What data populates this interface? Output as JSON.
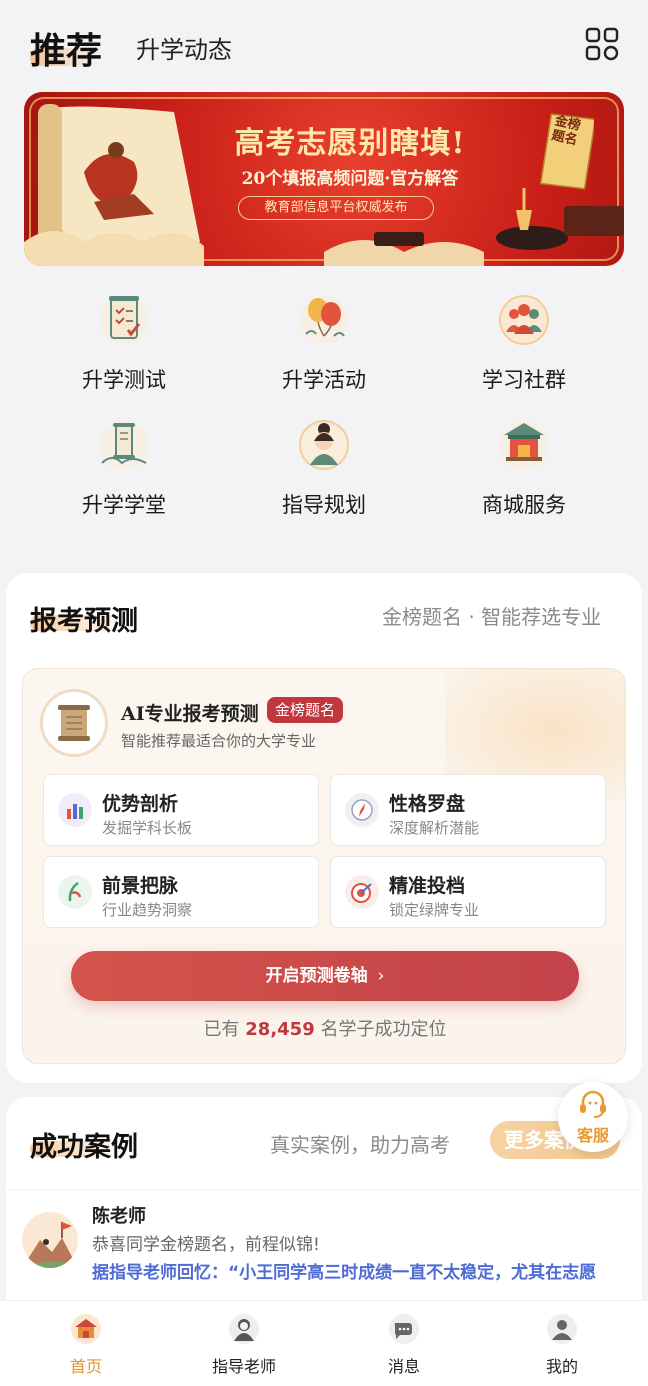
{
  "header": {
    "tab_active": "推荐",
    "tab_other": "升学动态"
  },
  "banner": {
    "title": "高考志愿别瞎填!",
    "subtitle": "20个填报高频问题·官方解答",
    "tag": "教育部信息平台权威发布",
    "seal": "金榜题名"
  },
  "quick_grid": [
    {
      "label": "升学测试",
      "icon": "checklist-scroll-icon"
    },
    {
      "label": "升学活动",
      "icon": "balloons-icon"
    },
    {
      "label": "学习社群",
      "icon": "community-people-icon"
    },
    {
      "label": "升学学堂",
      "icon": "scroll-lecture-icon"
    },
    {
      "label": "指导规划",
      "icon": "advisor-portrait-icon"
    },
    {
      "label": "商城服务",
      "icon": "shop-pavilion-icon"
    }
  ],
  "forecast": {
    "title": "报考预测",
    "subtitle": "金榜题名 · 智能荐选专业",
    "ai_title": "AI专业报考预测",
    "ai_badge": "金榜题名",
    "ai_desc": "智能推荐最适合你的大学专业",
    "features": [
      {
        "title": "优势剖析",
        "desc": "发掘学科长板",
        "icon": "bar-chart-icon"
      },
      {
        "title": "性格罗盘",
        "desc": "深度解析潜能",
        "icon": "compass-icon"
      },
      {
        "title": "前景把脉",
        "desc": "行业趋势洞察",
        "icon": "trend-leaf-icon"
      },
      {
        "title": "精准投档",
        "desc": "锁定绿牌专业",
        "icon": "target-icon"
      }
    ],
    "cta": "开启预测卷轴",
    "stat_prefix": "已有",
    "stat_number": "28,459",
    "stat_suffix": "名学子成功定位"
  },
  "cases": {
    "title": "成功案例",
    "subtitle": "真实案例，助力高考",
    "more": "更多案例",
    "item": {
      "name": "陈老师",
      "message": "恭喜同学金榜题名，前程似锦!",
      "quote": "据指导老师回忆：“小王同学高三时成绩一直不太稳定，尤其在志愿"
    }
  },
  "service": {
    "label": "客服"
  },
  "nav": [
    {
      "label": "首页",
      "icon": "home-pavilion-icon",
      "active": true
    },
    {
      "label": "指导老师",
      "icon": "teacher-icon",
      "active": false
    },
    {
      "label": "消息",
      "icon": "message-icon",
      "active": false
    },
    {
      "label": "我的",
      "icon": "profile-icon",
      "active": false
    }
  ],
  "colors": {
    "accent_red": "#c0383d",
    "accent_orange": "#e0962c",
    "link_blue": "#4f6bd6"
  }
}
